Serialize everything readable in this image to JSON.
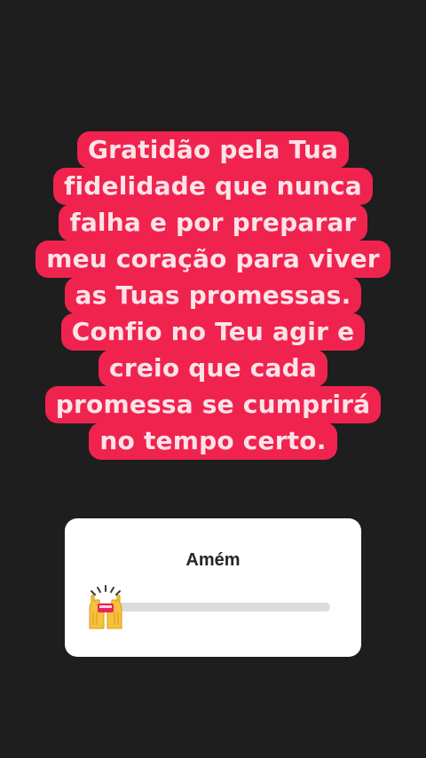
{
  "story": {
    "caption_lines": [
      "Gratidão pela Tua",
      "fidelidade que nunca",
      "falha e por preparar",
      "meu coração para viver",
      "as Tuas promessas.",
      "Confio no Teu agir e",
      "creio que cada",
      "promessa se cumprirá",
      "no tempo certo."
    ],
    "caption_bg_color": "#f0234f",
    "caption_text_color": "#fde3e8"
  },
  "slider_sticker": {
    "question": "Amém",
    "emoji_icon": "raising-hands-icon",
    "level": 0
  }
}
